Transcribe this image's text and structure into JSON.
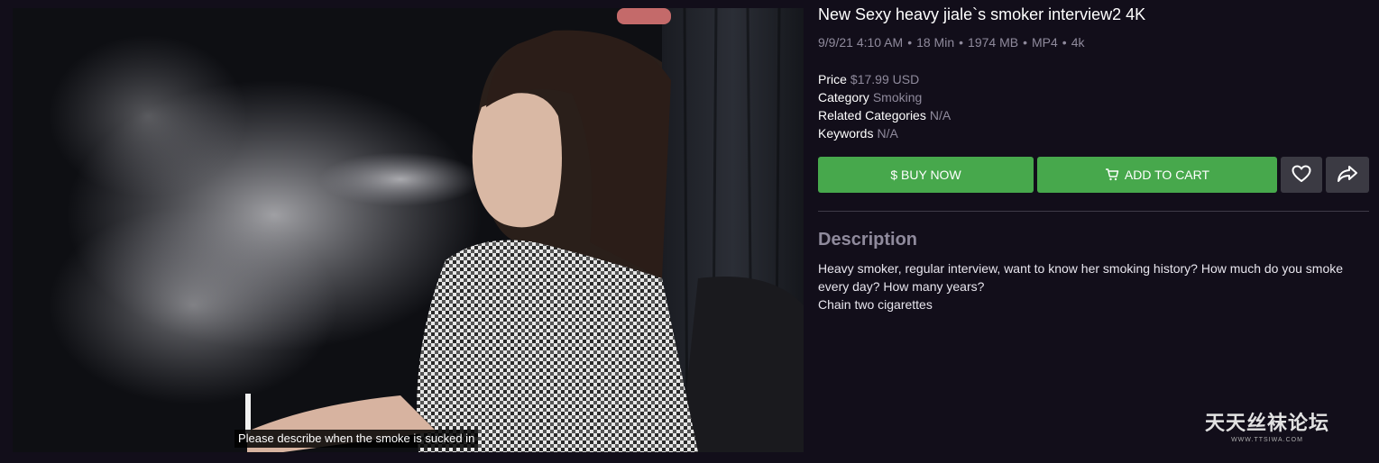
{
  "preview": {
    "caption": "Please describe when the smoke is sucked in"
  },
  "product": {
    "title": "New Sexy heavy jiale`s smoker interview2 4K",
    "meta": {
      "date": "9/9/21 4:10 AM",
      "duration": "18 Min",
      "size": "1974 MB",
      "format": "MP4",
      "quality": "4k",
      "separator": "•"
    },
    "fields": {
      "price_label": "Price",
      "price_value": "$17.99 USD",
      "category_label": "Category",
      "category_value": "Smoking",
      "related_label": "Related Categories",
      "related_value": "N/A",
      "keywords_label": "Keywords",
      "keywords_value": "N/A"
    }
  },
  "actions": {
    "buy_now": "$ BUY NOW",
    "add_to_cart": "ADD TO CART",
    "favorite_icon": "heart-icon",
    "share_icon": "share-arrow-icon"
  },
  "description": {
    "heading": "Description",
    "lines": [
      "Heavy smoker, regular interview, want to know her smoking history? How much do you smoke every day? How many years?",
      "Chain two cigarettes"
    ]
  },
  "watermark": {
    "text": "天天丝袜论坛",
    "url": "WWW.TTSIWA.COM"
  },
  "colors": {
    "background": "#120e1a",
    "accent_green": "#47a84c",
    "muted_text": "#8f8a9c",
    "icon_button": "#3b3a43"
  }
}
